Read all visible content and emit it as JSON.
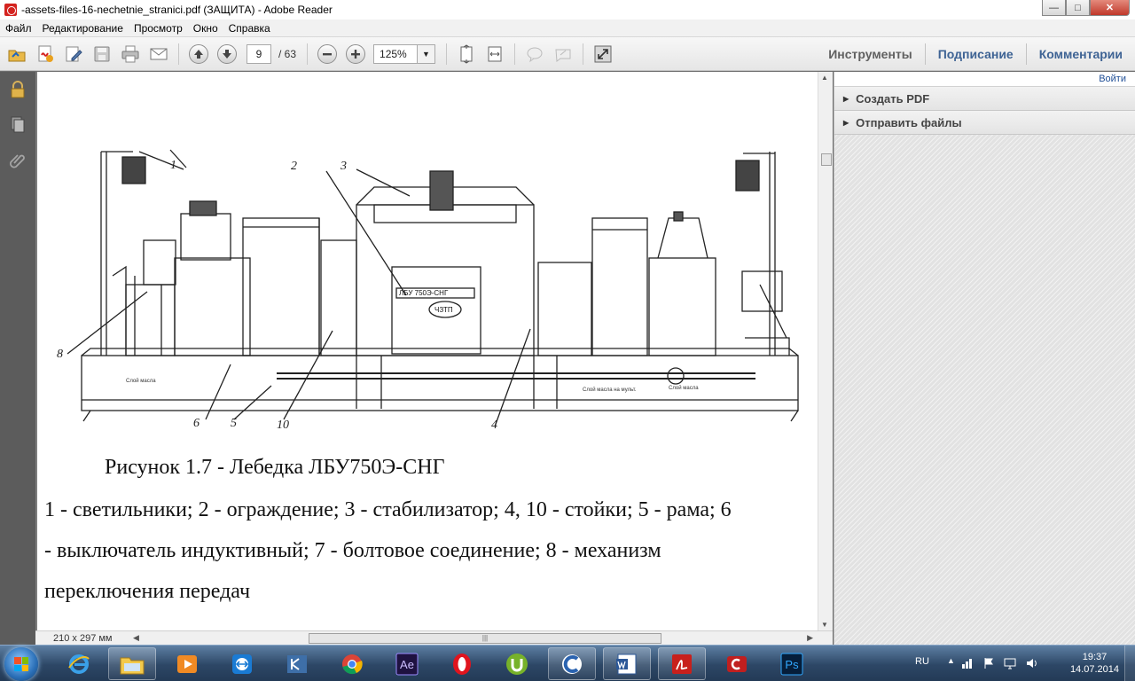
{
  "window": {
    "title": "-assets-files-16-nechetnie_stranici.pdf (ЗАЩИТА) - Adobe Reader",
    "minimize_label": "—",
    "maximize_label": "□",
    "close_label": "✕"
  },
  "menu": {
    "items": [
      {
        "label": "Файл"
      },
      {
        "label": "Редактирование"
      },
      {
        "label": "Просмотр"
      },
      {
        "label": "Окно"
      },
      {
        "label": "Справка"
      }
    ]
  },
  "toolbar": {
    "current_page": "9",
    "total_pages": "/ 63",
    "zoom": "125%",
    "links": {
      "tools": "Инструменты",
      "sign": "Подписание",
      "comment": "Комментарии"
    }
  },
  "right_panel": {
    "login": "Войти",
    "items": [
      {
        "label": "Создать PDF"
      },
      {
        "label": "Отправить файлы"
      }
    ]
  },
  "document": {
    "figure_labels": [
      "1",
      "2",
      "3",
      "4",
      "5",
      "6",
      "8",
      "10"
    ],
    "caption": "Рисунок 1.7 - Лебедка ЛБУ750Э-СНГ",
    "legend_lines": [
      "1 - светильники; 2 - ограждение; 3 - стабилизатор; 4, 10 - стойки; 5 - рама; 6",
      "- выключатель индуктивный; 7 - болтовое соединение; 8 - механизм",
      "переключения передач"
    ],
    "page_size": "210 x 297 мм",
    "plate_text": "ЛБУ 750Э-СНГ",
    "badge_text": "ЧЗТП"
  },
  "taskbar": {
    "apps": [
      {
        "icon": "ie-icon"
      },
      {
        "icon": "file-explorer-icon"
      },
      {
        "icon": "media-player-icon"
      },
      {
        "icon": "teamviewer-icon"
      },
      {
        "icon": "app-icon"
      },
      {
        "icon": "chrome-icon"
      },
      {
        "icon": "after-effects-icon"
      },
      {
        "icon": "opera-icon"
      },
      {
        "icon": "utorrent-icon"
      },
      {
        "icon": "ccleaner-icon"
      },
      {
        "icon": "word-icon"
      },
      {
        "icon": "adobe-reader-icon"
      },
      {
        "icon": "app-icon"
      },
      {
        "icon": "photoshop-icon"
      }
    ],
    "ae_label": "Ae",
    "ps_label": "Ps",
    "lang": "RU",
    "time": "19:37",
    "date": "14.07.2014"
  }
}
